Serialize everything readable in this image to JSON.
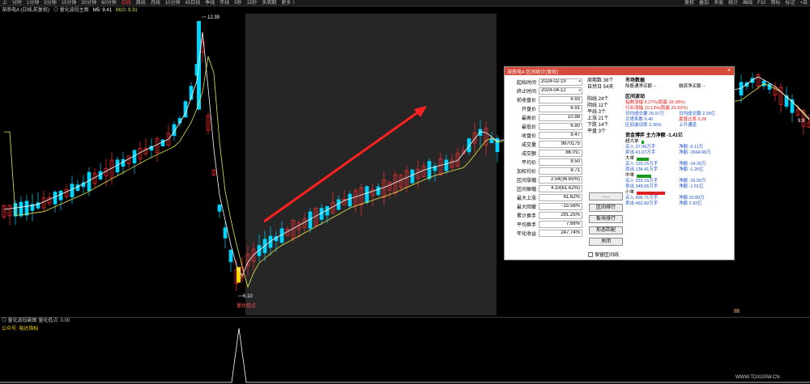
{
  "toolbar": {
    "left": [
      "上",
      "分时",
      "1分钟",
      "5分钟",
      "15分钟",
      "30分钟",
      "60分钟",
      "日线",
      "周线",
      "月线",
      "10分钟",
      "45日线",
      "季线",
      "年线",
      "5秒",
      "15秒",
      "多周期",
      "更多 〉"
    ],
    "active_index": 7,
    "right": [
      "复权",
      "叠加",
      "多股",
      "统计",
      "画线",
      "F10",
      "简标",
      "标记",
      "+自"
    ]
  },
  "chart_header": {
    "title": "深南电A (日线,前复权)",
    "indicator": "◎ 量化波段主图",
    "ma5": "M5: 9.41",
    "ma10": "M10: 9.31"
  },
  "price_labels": {
    "high": "12.39",
    "low": "6.10",
    "low_marker": "量化低点"
  },
  "right_marks": {
    "a": "9.9",
    "b": ""
  },
  "sub_chart": {
    "header": "◎ 量化波段副图  量化低点: 0.00",
    "note": "公众号: 裕达指标"
  },
  "watermark": "WWW.TDXGSW.CN",
  "dialog": {
    "title": "深南电A 区间统计(复权)",
    "close": "×",
    "fields": [
      {
        "label": "起始时间",
        "value": "2024-02-19",
        "type": "date"
      },
      {
        "label": "终止时间",
        "value": "2024-04-12",
        "type": "date"
      },
      {
        "label": "前收盘价",
        "value": "6.93"
      },
      {
        "label": "开盘价",
        "value": "6.91"
      },
      {
        "label": "最高价",
        "value": "10.98"
      },
      {
        "label": "最低价",
        "value": "6.80"
      },
      {
        "label": "收盘价",
        "value": "9.47"
      },
      {
        "label": "成交量",
        "value": "9870175"
      },
      {
        "label": "成交额",
        "value": "86.0亿"
      },
      {
        "label": "平均价",
        "value": "8.50"
      },
      {
        "label": "加权均价",
        "value": "8.71"
      },
      {
        "label": "区间涨幅",
        "value": "2.54(36.65%)"
      },
      {
        "label": "区间振幅",
        "value": "4.19(61.62%)"
      },
      {
        "label": "最大上涨",
        "value": "61.62%"
      },
      {
        "label": "最大回撤",
        "value": "-15.56%"
      },
      {
        "label": "累计换手",
        "value": "291.25%"
      },
      {
        "label": "平均换手",
        "value": "7.66%"
      },
      {
        "label": "年化收益",
        "value": "247.74%"
      }
    ],
    "mid": {
      "period": "周期数  38个",
      "natural": "自然日  54天",
      "yang": "阳线 24个",
      "yin": "阴线 11个",
      "flat": "平线  3个",
      "up": "上涨  21个",
      "down": "下跌  14个",
      "level": "平盘  3个"
    },
    "buttons": [
      "......",
      "区间排行",
      "板块排行",
      "形态匹配",
      "关闭"
    ],
    "checkbox": "保留区间线",
    "market": {
      "title": "市场数据",
      "r1a": "陆股通净买额 --",
      "r1b": "融资净买额 --"
    },
    "interval": {
      "title": "区间波动",
      "rows": [
        [
          "指数涨幅 8.27%(跑赢 28.38%)",
          "",
          "red"
        ],
        [
          "行业涨幅 10.13%(跑赢 26.52%)",
          "",
          "red"
        ],
        [
          "日均成交量 25.97万",
          "日均成交额 2.26亿",
          "blue"
        ],
        [
          "贝塔系数 0.40",
          "夏普比率 0.28",
          "mix"
        ],
        [
          "区间波动率 3.36%",
          "上升通道",
          "blue"
        ]
      ]
    },
    "capital": {
      "title": "资金博弈  主力净额 -1.41亿",
      "groups": [
        {
          "name": "超大单",
          "buy": "买入 37.96万手",
          "net": "净额 -3.11万",
          "sell": "卖出 41.07万手",
          "net2": "净额 -1564.68万",
          "bar_color": "#1a9a1a",
          "bar_frac": 0.05
        },
        {
          "name": "大单",
          "buy": "买入 120.15万手",
          "net": "净额 -14.26万",
          "sell": "卖出 134.41万手",
          "net2": "净额 -1.26亿",
          "bar_color": "#1a9a1a",
          "bar_frac": 0.3
        },
        {
          "name": "中单",
          "buy": "买入 332.15万手",
          "net": "净额 -16.50万",
          "sell": "卖出 348.65万手",
          "net2": "净额 -1.51亿",
          "bar_color": "#1a9a1a",
          "bar_frac": 0.35
        },
        {
          "name": "小单",
          "buy": "买入 496.71万手",
          "net": "净额 33.89万",
          "sell": "卖出 462.82万手",
          "net2": "净额 2.92亿",
          "bar_color": "#e02020",
          "bar_frac": 0.7
        }
      ]
    }
  },
  "colors": {
    "up": "#ff3030",
    "down": "#00d4ff",
    "ma5": "#ffffff",
    "ma10": "#e8e84a",
    "arrow": "#ff2020",
    "highlight": "#242424"
  }
}
